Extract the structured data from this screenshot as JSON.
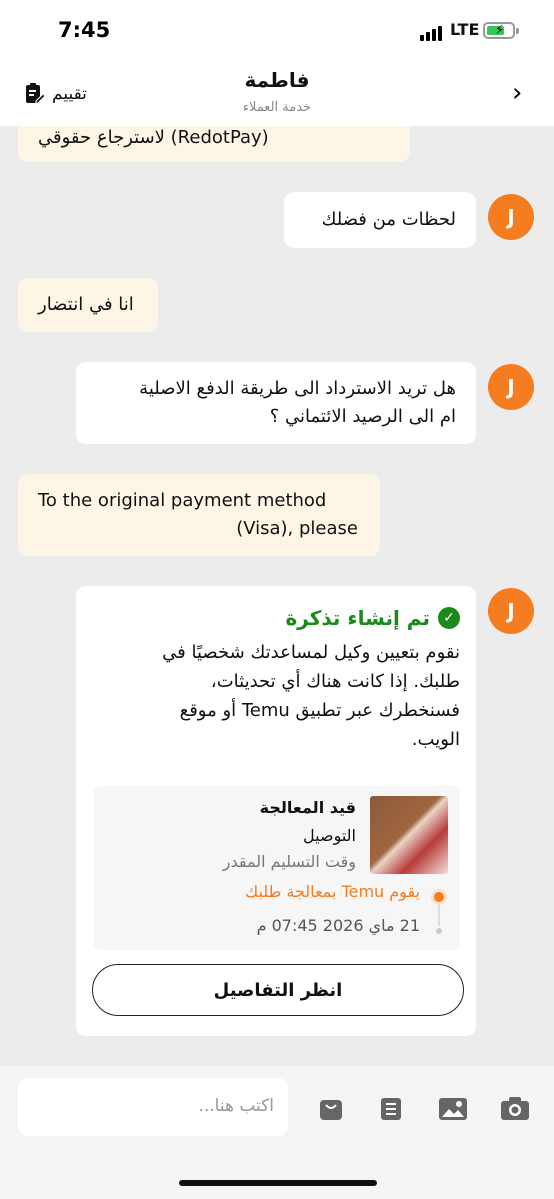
{
  "status_bar": {
    "time": "7:45",
    "network": "LTE"
  },
  "header": {
    "title": "فاطمة",
    "subtitle": "خدمة العملاء",
    "rate_label": "تقييم",
    "back_icon": "chevron-right-icon"
  },
  "messages": {
    "m0": "(RedotPay) لاسترجاع حقوقي",
    "m1": "لحظات من فضلك",
    "m2": "انا في انتضار",
    "m3_line1": "هل تريد الاسترداد الى طريقة الدفع الاصلية",
    "m3_line2": "ام الى الرصيد الائتماني ؟",
    "m4_line1": "To the original payment method",
    "m4_line2": "(Visa), please"
  },
  "avatar_letter": "J",
  "ticket": {
    "title": "تم إنشاء تذكرة",
    "body_line1": "نقوم بتعيين وكيل لمساعدتك شخصيًا في",
    "body_line2": "طلبك. إذا كانت هناك أي تحديثات،",
    "body_line3": "فسنخطرك عبر تطبيق Temu أو موقع",
    "body_line4": "الويب.",
    "order_status": "قيد المعالجة",
    "order_shipping": "التوصيل",
    "order_eta": "وقت التسليم المقدر",
    "tracking_text": "يقوم Temu بمعالجة طلبك",
    "tracking_date": "21 ماي 2026 07:45 م",
    "details_button": "انظر التفاصيل"
  },
  "composer": {
    "placeholder": "اكتب هنا..."
  },
  "colors": {
    "accent": "#f57c1f",
    "success": "#1b8a1b",
    "user_bubble": "#fdf6e6"
  }
}
